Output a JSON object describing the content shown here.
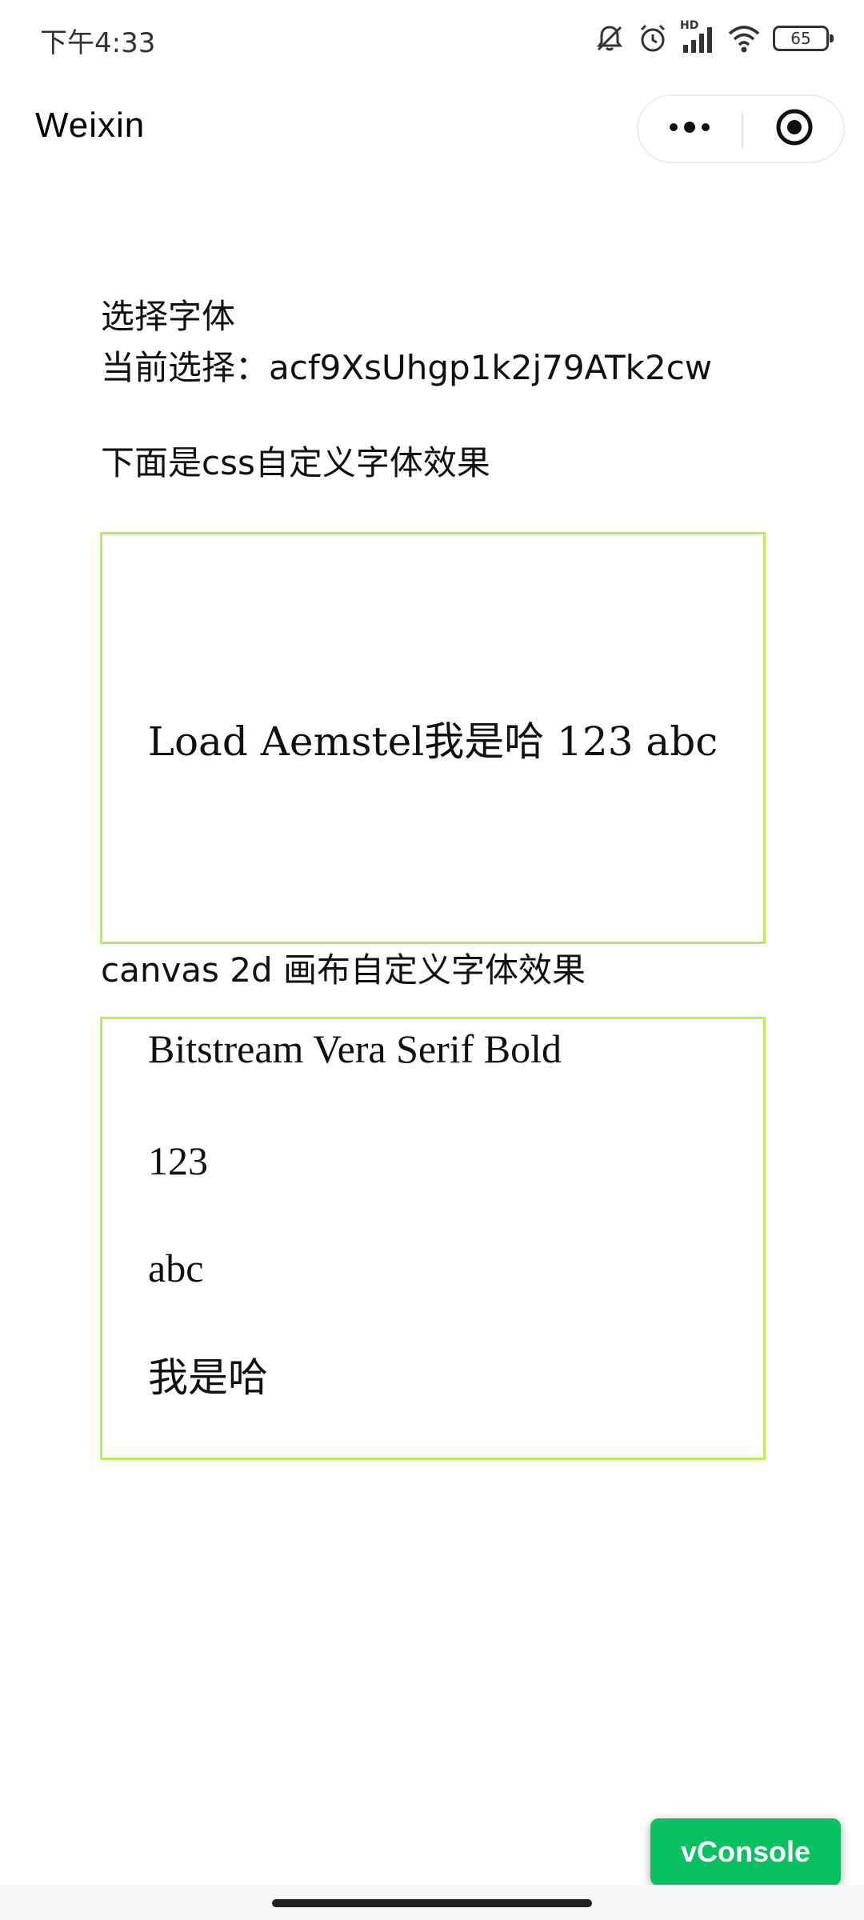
{
  "status_bar": {
    "time": "下午4:33",
    "hd_label": "HD",
    "battery": "65"
  },
  "nav": {
    "title": "Weixin",
    "more_icon": "more-dots-icon",
    "close_icon": "target-circle-icon"
  },
  "content": {
    "select_font_label": "选择字体",
    "current_selection": "当前选择：acf9XsUhgp1k2j79ATk2cw",
    "css_heading": "下面是css自定义字体效果",
    "css_sample": "Load Aemstel我是哈 123 abc",
    "canvas_heading": "canvas 2d 画布自定义字体效果",
    "canvas_lines": [
      "Bitstream Vera Serif Bold",
      "123",
      "abc",
      "我是哈"
    ]
  },
  "vconsole": {
    "label": "vConsole"
  },
  "colors": {
    "box_border": "#b7ec5b",
    "vconsole_bg": "#07c160"
  }
}
